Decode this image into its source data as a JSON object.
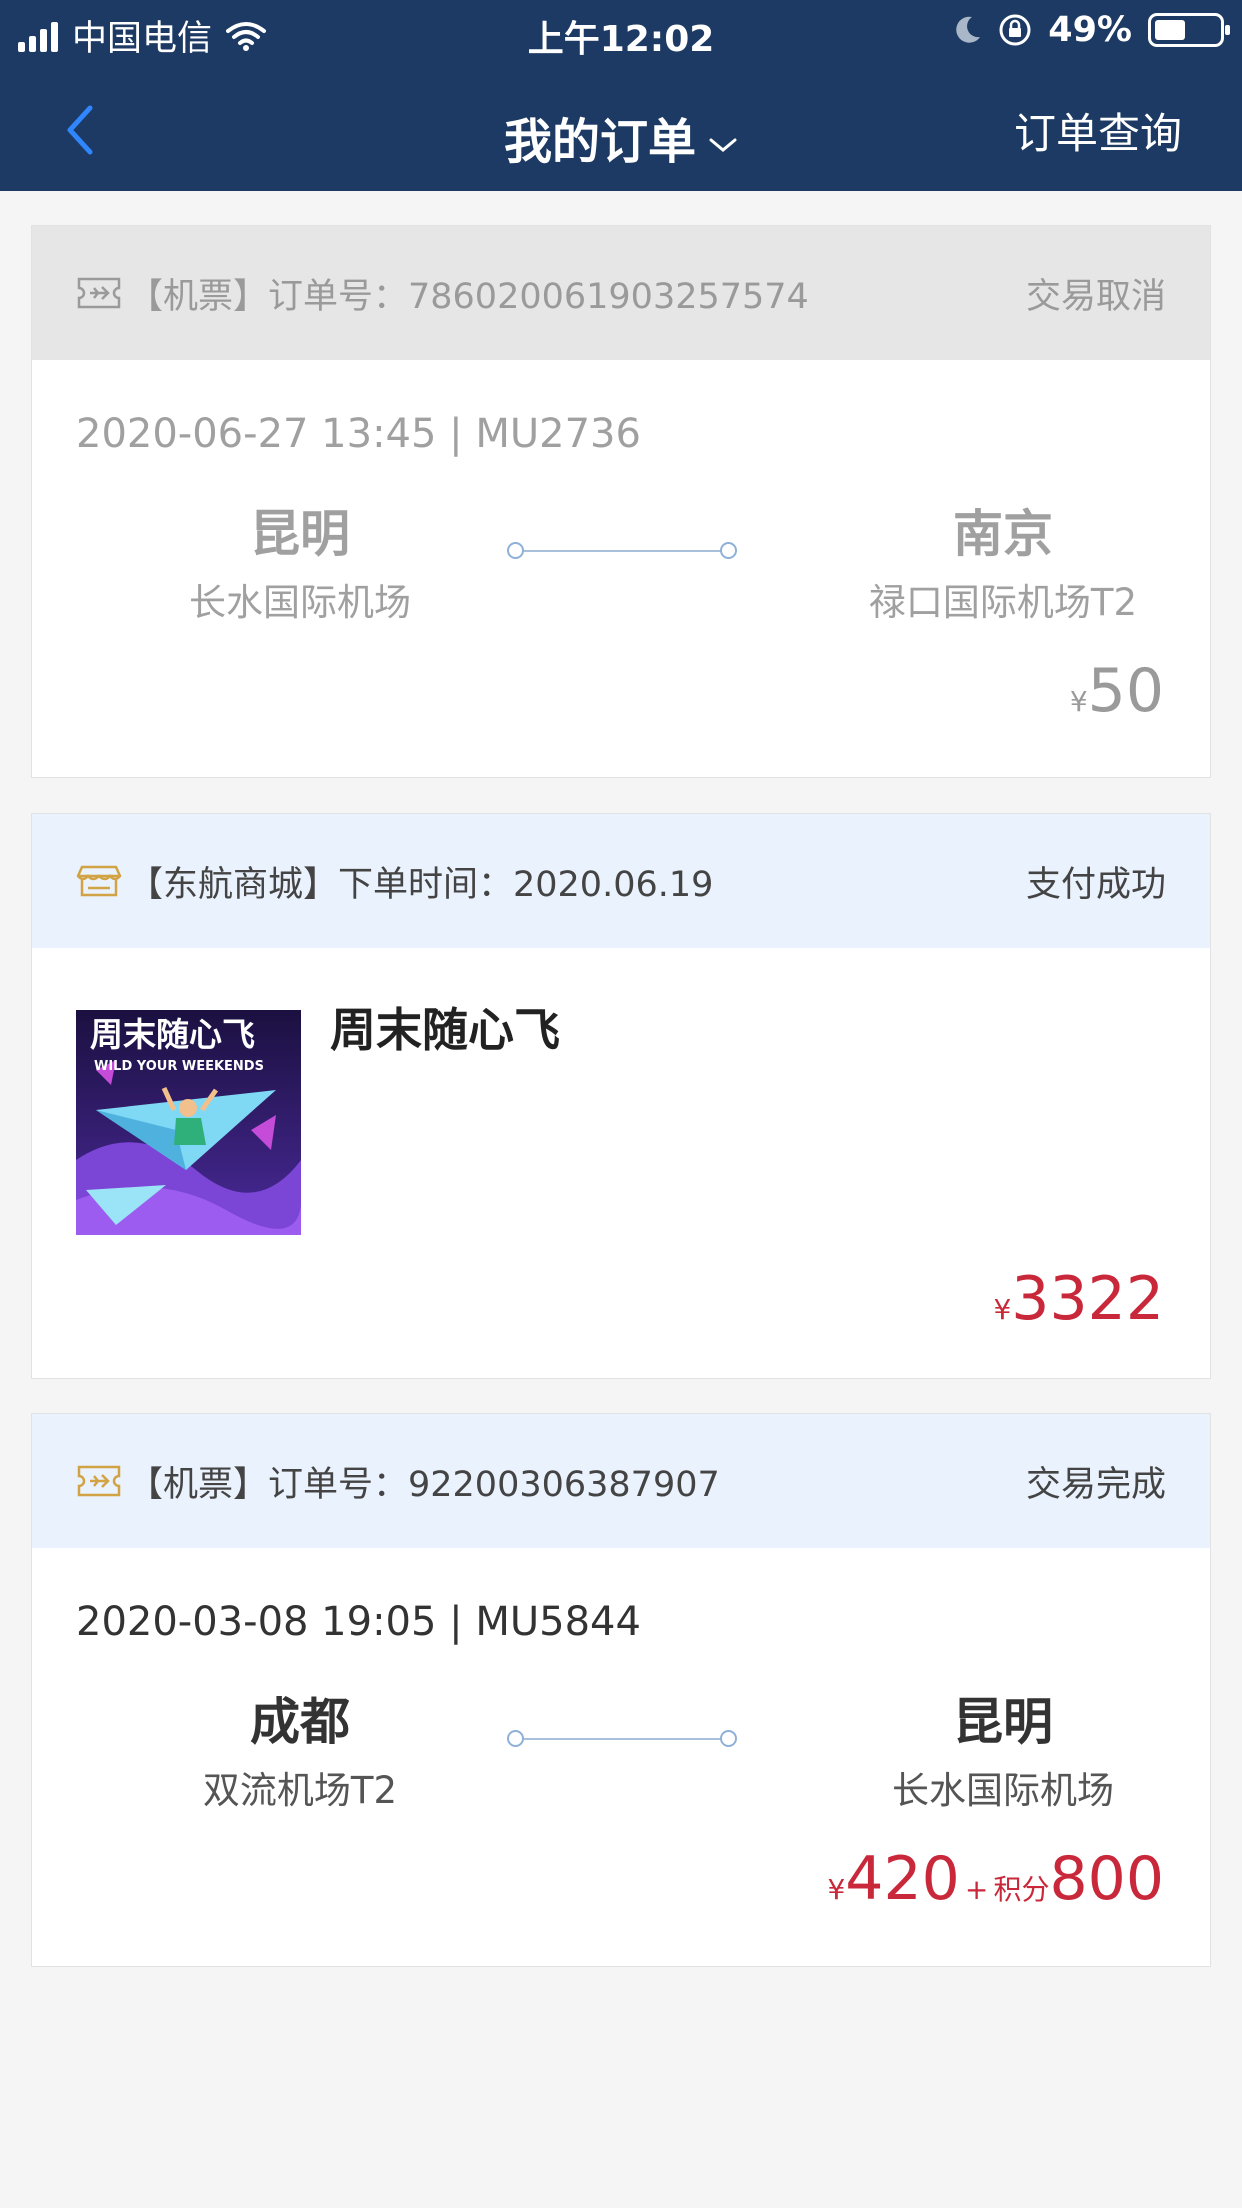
{
  "status_bar": {
    "carrier": "中国电信",
    "time": "上午12:02",
    "battery": "49%",
    "battery_level": 0.49
  },
  "nav": {
    "title": "我的订单",
    "query_link": "订单查询"
  },
  "orders": [
    {
      "header": "【机票】订单号：786020061903257574",
      "status": "交易取消",
      "flight": "2020-06-27 13:45 | MU2736",
      "from_city": "昆明",
      "from_airport": "长水国际机场",
      "to_city": "南京",
      "to_airport": "禄口国际机场T2",
      "currency": "¥",
      "price": "50"
    },
    {
      "header": "【东航商城】下单时间：2020.06.19",
      "status": "支付成功",
      "product_title": "周末随心飞",
      "image_title": "周末随心飞",
      "image_subtitle": "WILD YOUR WEEKENDS",
      "currency": "¥",
      "price": "3322"
    },
    {
      "header": "【机票】订单号：92200306387907",
      "status": "交易完成",
      "flight": "2020-03-08 19:05 | MU5844",
      "from_city": "成都",
      "from_airport": "双流机场T2",
      "to_city": "昆明",
      "to_airport": "长水国际机场",
      "currency": "¥",
      "price": "420",
      "plus": "+",
      "points_label": "积分",
      "points": "800"
    }
  ]
}
